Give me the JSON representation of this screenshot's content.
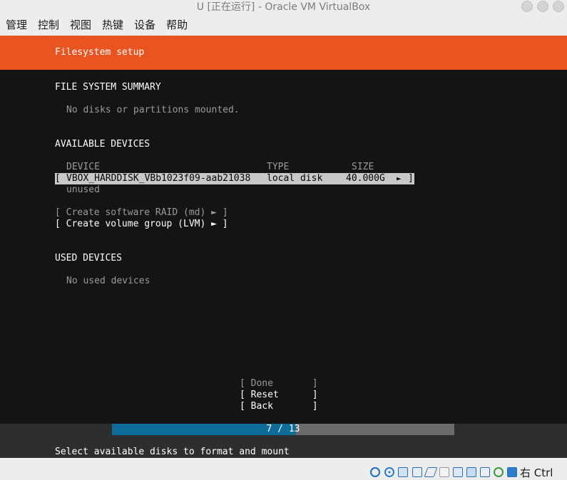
{
  "window": {
    "title": "U [正在运行] - Oracle VM VirtualBox"
  },
  "menubar": {
    "items": [
      "管理",
      "控制",
      "视图",
      "热键",
      "设备",
      "帮助"
    ]
  },
  "installer": {
    "header": "Filesystem setup",
    "fs_summary": {
      "heading": "FILE SYSTEM SUMMARY",
      "empty": "No disks or partitions mounted."
    },
    "available": {
      "heading": "AVAILABLE DEVICES",
      "columns": {
        "device": "DEVICE",
        "type": "TYPE",
        "size": "SIZE"
      },
      "device": {
        "open": "[",
        "name": "VBOX_HARDDISK_VBb1023f09-aab21038",
        "type": "local disk",
        "size": "40.000G",
        "arrow": "►",
        "close": "]",
        "status": "unused"
      },
      "actions": [
        {
          "text": "[ Create software RAID (md) ► ]",
          "enabled": false
        },
        {
          "text": "[ Create volume group (LVM) ► ]",
          "enabled": true
        }
      ]
    },
    "used": {
      "heading": "USED DEVICES",
      "empty": "No used devices"
    },
    "buttons": [
      {
        "text": "[ Done       ]",
        "enabled": false
      },
      {
        "text": "[ Reset      ]",
        "enabled": true
      },
      {
        "text": "[ Back       ]",
        "enabled": true
      }
    ],
    "progress": {
      "text": "7 / 13",
      "current": 7,
      "total": 13
    },
    "footer": "Select available disks to format and mount"
  },
  "statusbar": {
    "icons": [
      "hard-disk-icon",
      "optical-drive-icon",
      "audio-icon",
      "network-icon",
      "usb-icon",
      "shared-folder-icon",
      "display-icon",
      "video-capture-icon",
      "vm-state-icon",
      "cpu-icon",
      "mouse-integration-icon",
      "keyboard-icon"
    ],
    "host_key": "右 Ctrl"
  },
  "colors": {
    "header_orange": "#e95420",
    "progress_blue": "#0e6c9a",
    "screen_bg": "#141414"
  }
}
